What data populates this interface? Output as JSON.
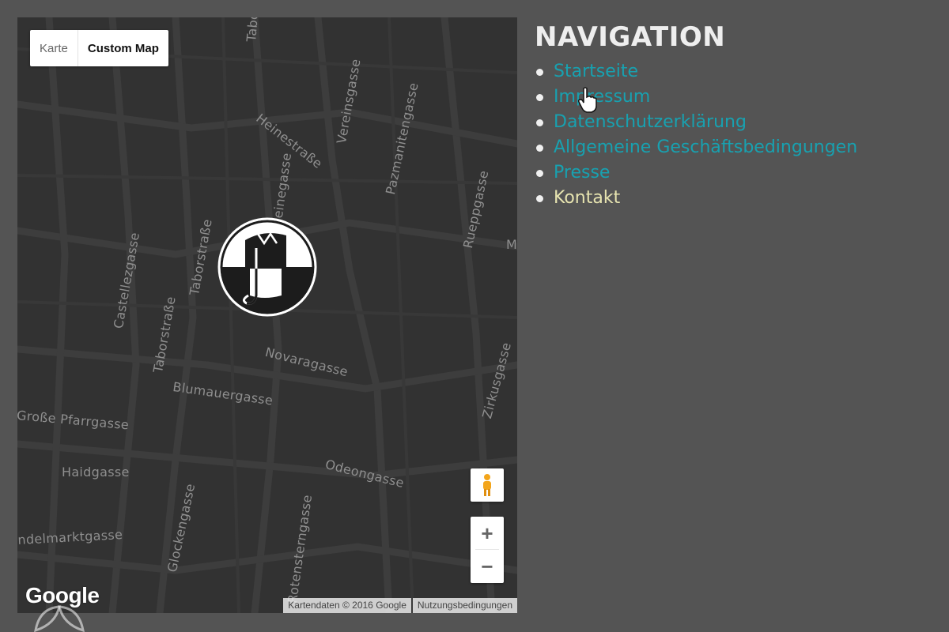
{
  "map": {
    "map_types": [
      "Karte",
      "Custom Map"
    ],
    "selected_map_type": "Custom Map",
    "street_labels": {
      "tabors_top": "Tabors",
      "vereinsgasse": "Vereinsgasse",
      "heinestrasse": "Heinestraße",
      "pazmanitengasse": "Pazmanitengasse",
      "rueppgasse": "Rueppgasse",
      "castellezgasse": "Castellezgasse",
      "taborstrasse_1": "Taborstraße",
      "taborstrasse_2": "Taborstraße",
      "heinegasse": "Heinegasse",
      "novaragasse": "Novaragasse",
      "blumauergasse": "Blumauergasse",
      "zirkusgasse": "Zirkusgasse",
      "grosse_pfarrgasse": "Große Pfarrgasse",
      "haidgasse": "Haidgasse",
      "odeongasse": "Odeongasse",
      "glockengasse": "Glockengasse",
      "rotensterngasse": "Rotensterngasse",
      "karmelitermarktgasse": "ndelmarktgasse",
      "edge_m": "M"
    },
    "google_logo": "Google",
    "attribution": "Kartendaten © 2016 Google",
    "terms": "Nutzungsbedingungen",
    "zoom_in": "+",
    "zoom_out": "−",
    "colors": {
      "map_bg": "#323232",
      "street": "#3e3e3e",
      "label": "#8f8f8f"
    }
  },
  "navigation": {
    "title": "NAVIGATION",
    "items": [
      {
        "label": "Startseite"
      },
      {
        "label": "Impressum"
      },
      {
        "label": "Datenschutzerklärung"
      },
      {
        "label": "Allgemeine Geschäftsbedingungen"
      },
      {
        "label": "Presse"
      },
      {
        "label": "Kontakt"
      }
    ],
    "active_item": "Kontakt",
    "colors": {
      "link": "#18a1b0",
      "active": "#e7e4b0",
      "title": "#eeeeee",
      "page_bg": "#545454"
    }
  }
}
